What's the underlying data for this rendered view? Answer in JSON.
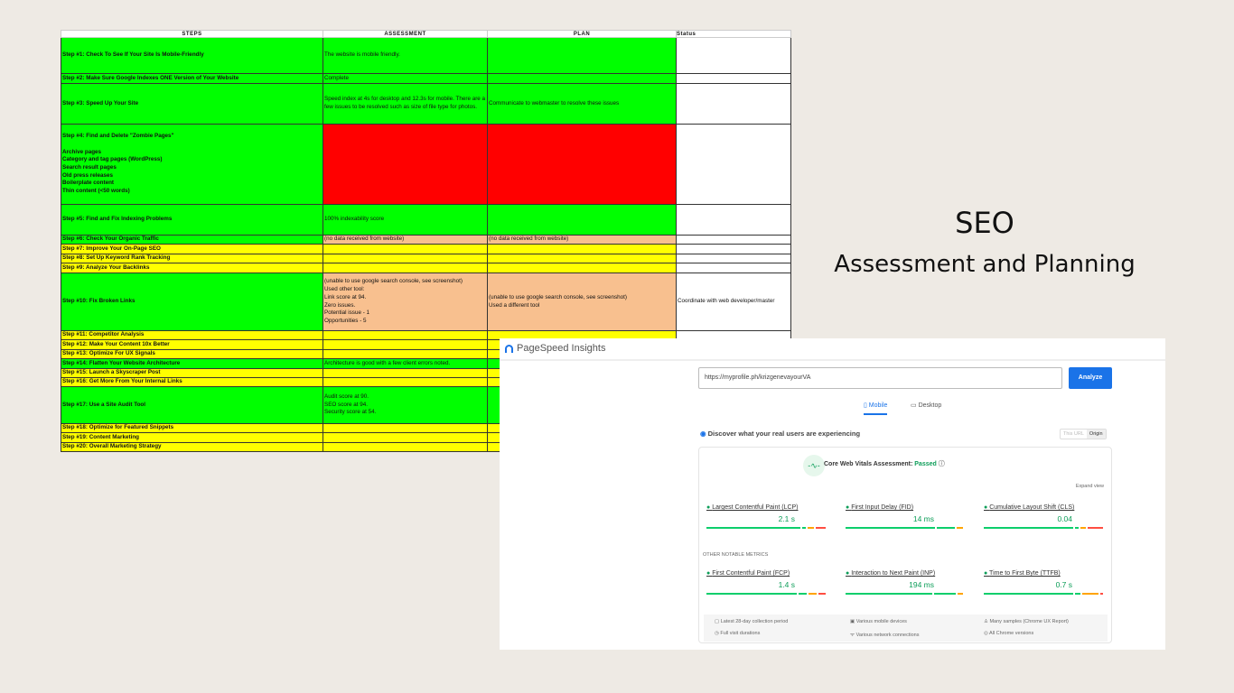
{
  "sheet": {
    "headers": [
      "STEPS",
      "ASSESSMENT",
      "PLAN",
      "Status"
    ],
    "rows": [
      {
        "step": "Step #1: Check To See If Your Site Is Mobile-Friendly",
        "assessment": "The website is mobile friendly.",
        "plan": "",
        "status": "",
        "colors": [
          "#00ff00",
          "#00ff00",
          "#00ff00",
          "#ffffff"
        ]
      },
      {
        "step": "Step #2: Make Sure Google Indexes ONE Version of Your Website",
        "assessment": "Complete",
        "plan": "",
        "status": "",
        "colors": [
          "#00ff00",
          "#00ff00",
          "#00ff00",
          "#ffffff"
        ]
      },
      {
        "step": "Step #3: Speed Up Your Site",
        "assessment": "Speed index at 4s for desktop and 12.3s for mobile. There are a few issues to be resolved such as size of file type for photos.",
        "plan": "Communicate to webmaster to resolve these issues",
        "status": "",
        "colors": [
          "#00ff00",
          "#00ff00",
          "#00ff00",
          "#ffffff"
        ]
      },
      {
        "step": "Step #4: Find and Delete \"Zombie Pages\"\n\nArchive pages\nCategory and tag pages (WordPress)\nSearch result pages\nOld press releases\nBoilerplate content\nThin content (<50 words)",
        "assessment": "",
        "plan": "",
        "status": "",
        "colors": [
          "#00ff00",
          "#ff0000",
          "#ff0000",
          "#ffffff"
        ]
      },
      {
        "step": "Step #5: Find and Fix Indexing Problems",
        "assessment": "100% indexability score",
        "plan": "",
        "status": "",
        "colors": [
          "#00ff00",
          "#00ff00",
          "#00ff00",
          "#ffffff"
        ]
      },
      {
        "step": "Step #6: Check Your Organic Traffic",
        "assessment": "(no data received from website)",
        "plan": "(no data received from website)",
        "status": "",
        "colors": [
          "#00ff00",
          "#f8c08f",
          "#f8c08f",
          "#ffffff"
        ]
      },
      {
        "step": "Step #7: Improve Your On-Page SEO",
        "assessment": "",
        "plan": "",
        "status": "",
        "colors": [
          "#ffff00",
          "#ffff00",
          "#ffff00",
          "#ffffff"
        ]
      },
      {
        "step": "Step #8: Set Up Keyword Rank Tracking",
        "assessment": "",
        "plan": "",
        "status": "",
        "colors": [
          "#ffff00",
          "#ffff00",
          "#ffff00",
          "#ffffff"
        ]
      },
      {
        "step": "Step #9: Analyze Your Backlinks",
        "assessment": "",
        "plan": "",
        "status": "",
        "colors": [
          "#ffff00",
          "#ffff00",
          "#ffff00",
          "#ffffff"
        ]
      },
      {
        "step": "Step #10: Fix Broken Links",
        "assessment": "(unable to use google search console, see screenshot)\nUsed other tool:\nLink score at 94.\nZero issues.\nPotential issue - 1\nOpportunities - 5",
        "plan": "(unable to use google search console, see screenshot)\nUsed a different tool",
        "status": "Coordinate with web developer/master",
        "colors": [
          "#00ff00",
          "#f8c08f",
          "#f8c08f",
          "#ffffff"
        ]
      },
      {
        "step": "Step #11: Competitor Analysis",
        "assessment": "",
        "plan": "",
        "status": "",
        "colors": [
          "#ffff00",
          "#ffff00",
          "#ffff00",
          "#ffffff"
        ]
      },
      {
        "step": "Step #12: Make Your Content 10x Better",
        "assessment": "",
        "plan": "",
        "status": "",
        "colors": [
          "#ffff00",
          "#ffff00",
          "#ffff00",
          "#ffffff"
        ]
      },
      {
        "step": "Step #13: Optimize For UX Signals",
        "assessment": "",
        "plan": "",
        "status": "",
        "colors": [
          "#ffff00",
          "#ffff00",
          "#ffff00",
          "#ffffff"
        ]
      },
      {
        "step": "Step #14: Flatten Your Website Architecture",
        "assessment": "Architecture is good with a few client errors noted.",
        "plan": "",
        "status": "",
        "colors": [
          "#00ff00",
          "#00ff00",
          "#00ff00",
          "#ffffff"
        ]
      },
      {
        "step": "Step #15: Launch a Skyscraper Post",
        "assessment": "",
        "plan": "",
        "status": "",
        "colors": [
          "#ffff00",
          "#ffff00",
          "#ffff00",
          "#ffffff"
        ]
      },
      {
        "step": "Step #16: Get More From Your Internal Links",
        "assessment": "",
        "plan": "",
        "status": "",
        "colors": [
          "#ffff00",
          "#ffff00",
          "#ffff00",
          "#ffffff"
        ]
      },
      {
        "step": "Step #17: Use a Site Audit Tool",
        "assessment": "Audit score at 90.\nSEO score at 94.\nSecurity score at 54.",
        "plan": "",
        "status": "",
        "colors": [
          "#00ff00",
          "#00ff00",
          "#00ff00",
          "#ffffff"
        ]
      },
      {
        "step": "Step #18: Optimize for Featured Snippets",
        "assessment": "",
        "plan": "",
        "status": "",
        "colors": [
          "#ffff00",
          "#ffff00",
          "#ffff00",
          "#ffffff"
        ]
      },
      {
        "step": "Step #19: Content Marketing",
        "assessment": "",
        "plan": "",
        "status": "",
        "colors": [
          "#ffff00",
          "#ffff00",
          "#ffff00",
          "#ffffff"
        ]
      },
      {
        "step": "Step #20: Overall Marketing Strategy",
        "assessment": "",
        "plan": "",
        "status": "",
        "colors": [
          "#ffff00",
          "#ffff00",
          "#ffff00",
          "#ffffff"
        ]
      }
    ]
  },
  "title": {
    "line1": "SEO",
    "line2": "Assessment and Planning"
  },
  "psi": {
    "app_title": "PageSpeed Insights",
    "url": "https://myprofile.ph/krizgenevayourVA",
    "analyze_label": "Analyze",
    "tabs": [
      "Mobile",
      "Desktop"
    ],
    "discover": "Discover what your real users are experiencing",
    "toggle": [
      "This URL",
      "Origin"
    ],
    "cwv_label": "Core Web Vitals Assessment:",
    "cwv_status": "Passed",
    "expand": "Expand view",
    "other_label": "OTHER NOTABLE METRICS",
    "metrics": [
      {
        "label": "Largest Contentful Paint (LCP)",
        "value": "2.1 s"
      },
      {
        "label": "First Input Delay (FID)",
        "value": "14 ms"
      },
      {
        "label": "Cumulative Layout Shift (CLS)",
        "value": "0.04"
      },
      {
        "label": "First Contentful Paint (FCP)",
        "value": "1.4 s"
      },
      {
        "label": "Interaction to Next Paint (INP)",
        "value": "194 ms"
      },
      {
        "label": "Time to First Byte (TTFB)",
        "value": "0.7 s"
      }
    ],
    "footer": [
      "Latest 28-day collection period",
      "Various mobile devices",
      "Many samples (Chrome UX Report)",
      "Full visit durations",
      "Various network connections",
      "All Chrome versions"
    ],
    "colors": {
      "good": "#0cce6b",
      "avg": "#ffa400",
      "poor": "#ff4e42",
      "accent": "#1a73e8"
    }
  }
}
